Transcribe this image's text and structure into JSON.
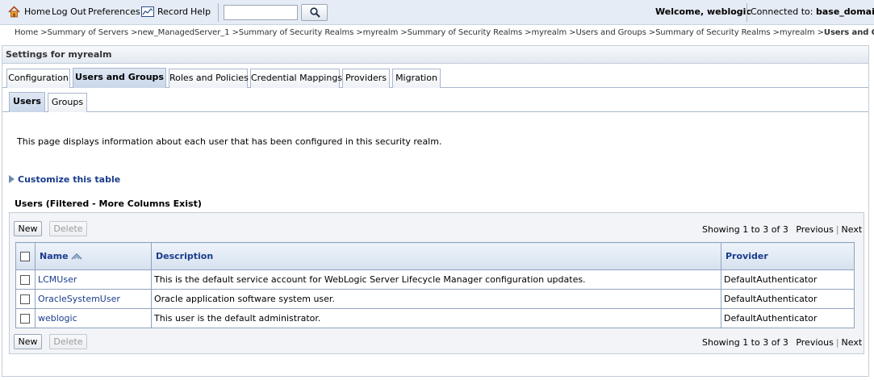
{
  "topbar": {
    "home": "Home",
    "logout": "Log Out",
    "preferences": "Preferences",
    "record": "Record",
    "help": "Help",
    "search_value": "",
    "welcome": "Welcome, weblogic",
    "connected_label": "Connected to:",
    "connected_domain": "base_domain"
  },
  "breadcrumb": {
    "items": [
      "Home >",
      "Summary of Servers >",
      "new_ManagedServer_1 >",
      "Summary of Security Realms >",
      "myrealm >",
      "Summary of Security Realms >",
      "myrealm >",
      "Users and Groups >",
      "Summary of Security Realms >",
      "myrealm >"
    ],
    "current": "Users and Groups"
  },
  "panel": {
    "title": "Settings for myrealm"
  },
  "tabs": [
    {
      "label": "Configuration",
      "active": false
    },
    {
      "label": "Users and Groups",
      "active": true
    },
    {
      "label": "Roles and Policies",
      "active": false
    },
    {
      "label": "Credential Mappings",
      "active": false
    },
    {
      "label": "Providers",
      "active": false
    },
    {
      "label": "Migration",
      "active": false
    }
  ],
  "subtabs": [
    {
      "label": "Users",
      "active": true
    },
    {
      "label": "Groups",
      "active": false
    }
  ],
  "content": {
    "info_text": "This page displays information about each user that has been configured in this security realm.",
    "customize_link": "Customize this table",
    "table_title": "Users (Filtered - More Columns Exist)"
  },
  "table": {
    "new_button": "New",
    "delete_button": "Delete",
    "pager_text": "Showing 1 to 3 of 3",
    "previous": "Previous",
    "next": "Next",
    "columns": [
      "Name",
      "Description",
      "Provider"
    ],
    "rows": [
      {
        "name": "LCMUser",
        "description": "This is the default service account for WebLogic Server Lifecycle Manager configuration updates.",
        "provider": "DefaultAuthenticator"
      },
      {
        "name": "OracleSystemUser",
        "description": "Oracle application software system user.",
        "provider": "DefaultAuthenticator"
      },
      {
        "name": "weblogic",
        "description": "This user is the default administrator.",
        "provider": "DefaultAuthenticator"
      }
    ]
  },
  "colors": {
    "link": "#1a3c8c",
    "topbar_bg": "#e6ecf5",
    "header_border": "#8fa3c0"
  }
}
